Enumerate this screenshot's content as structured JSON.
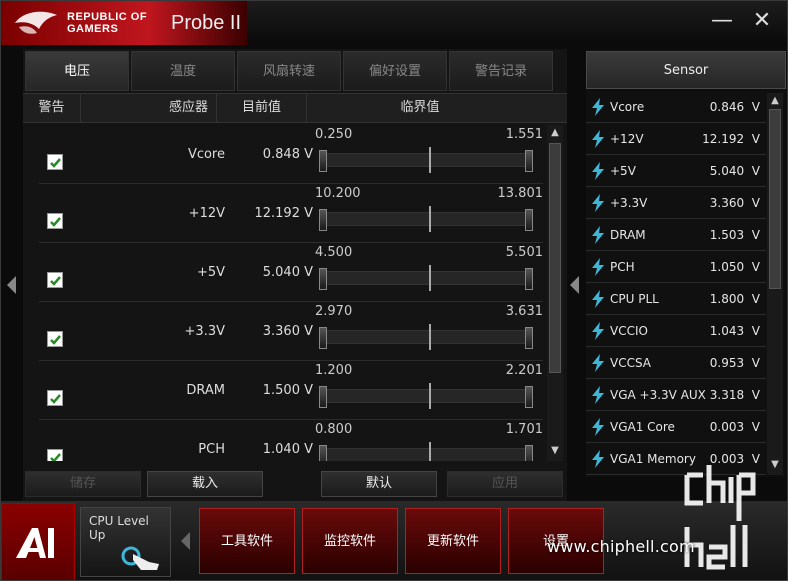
{
  "window": {
    "brand_line1": "REPUBLIC OF",
    "brand_line2": "GAMERS",
    "title": "Probe II",
    "minimize": "—",
    "close": "✕"
  },
  "tabs": [
    "电压",
    "温度",
    "风扇转速",
    "偏好设置",
    "警告记录"
  ],
  "active_tab": 0,
  "columns": {
    "alert": "警告",
    "sensor": "感应器",
    "current": "目前值",
    "threshold": "临界值"
  },
  "rows": [
    {
      "name": "Vcore",
      "value": "0.848 V",
      "low": "0.250",
      "high": "1.551",
      "checked": true
    },
    {
      "name": "+12V",
      "value": "12.192 V",
      "low": "10.200",
      "high": "13.801",
      "checked": true
    },
    {
      "name": "+5V",
      "value": "5.040 V",
      "low": "4.500",
      "high": "5.501",
      "checked": true
    },
    {
      "name": "+3.3V",
      "value": "3.360 V",
      "low": "2.970",
      "high": "3.631",
      "checked": true
    },
    {
      "name": "DRAM",
      "value": "1.500 V",
      "low": "1.200",
      "high": "2.201",
      "checked": true
    },
    {
      "name": "PCH",
      "value": "1.040 V",
      "low": "0.800",
      "high": "1.701",
      "checked": true
    }
  ],
  "buttons": {
    "save": "储存",
    "load": "载入",
    "default": "默认",
    "apply": "应用"
  },
  "sensor": {
    "title": "Sensor",
    "items": [
      {
        "name": "Vcore",
        "value": "0.846",
        "unit": "V"
      },
      {
        "name": "+12V",
        "value": "12.192",
        "unit": "V"
      },
      {
        "name": "+5V",
        "value": "5.040",
        "unit": "V"
      },
      {
        "name": "+3.3V",
        "value": "3.360",
        "unit": "V"
      },
      {
        "name": "DRAM",
        "value": "1.503",
        "unit": "V"
      },
      {
        "name": "PCH",
        "value": "1.050",
        "unit": "V"
      },
      {
        "name": "CPU PLL",
        "value": "1.800",
        "unit": "V"
      },
      {
        "name": "VCCIO",
        "value": "1.043",
        "unit": "V"
      },
      {
        "name": "VCCSA",
        "value": "0.953",
        "unit": "V"
      },
      {
        "name": "VGA +3.3V AUX",
        "value": "3.318",
        "unit": "V"
      },
      {
        "name": "VGA1 Core",
        "value": "0.003",
        "unit": "V"
      },
      {
        "name": "VGA1 Memory",
        "value": "0.003",
        "unit": "V"
      }
    ]
  },
  "dock": {
    "cpu_level": "CPU Level Up",
    "buttons": [
      "工具软件",
      "监控软件",
      "更新软件",
      "设置"
    ]
  },
  "watermark": {
    "url": "www.chiphell.com",
    "logo": "chip hell"
  },
  "colors": {
    "accent_red": "#c0161e",
    "sensor_icon": "#3fb6d8"
  }
}
